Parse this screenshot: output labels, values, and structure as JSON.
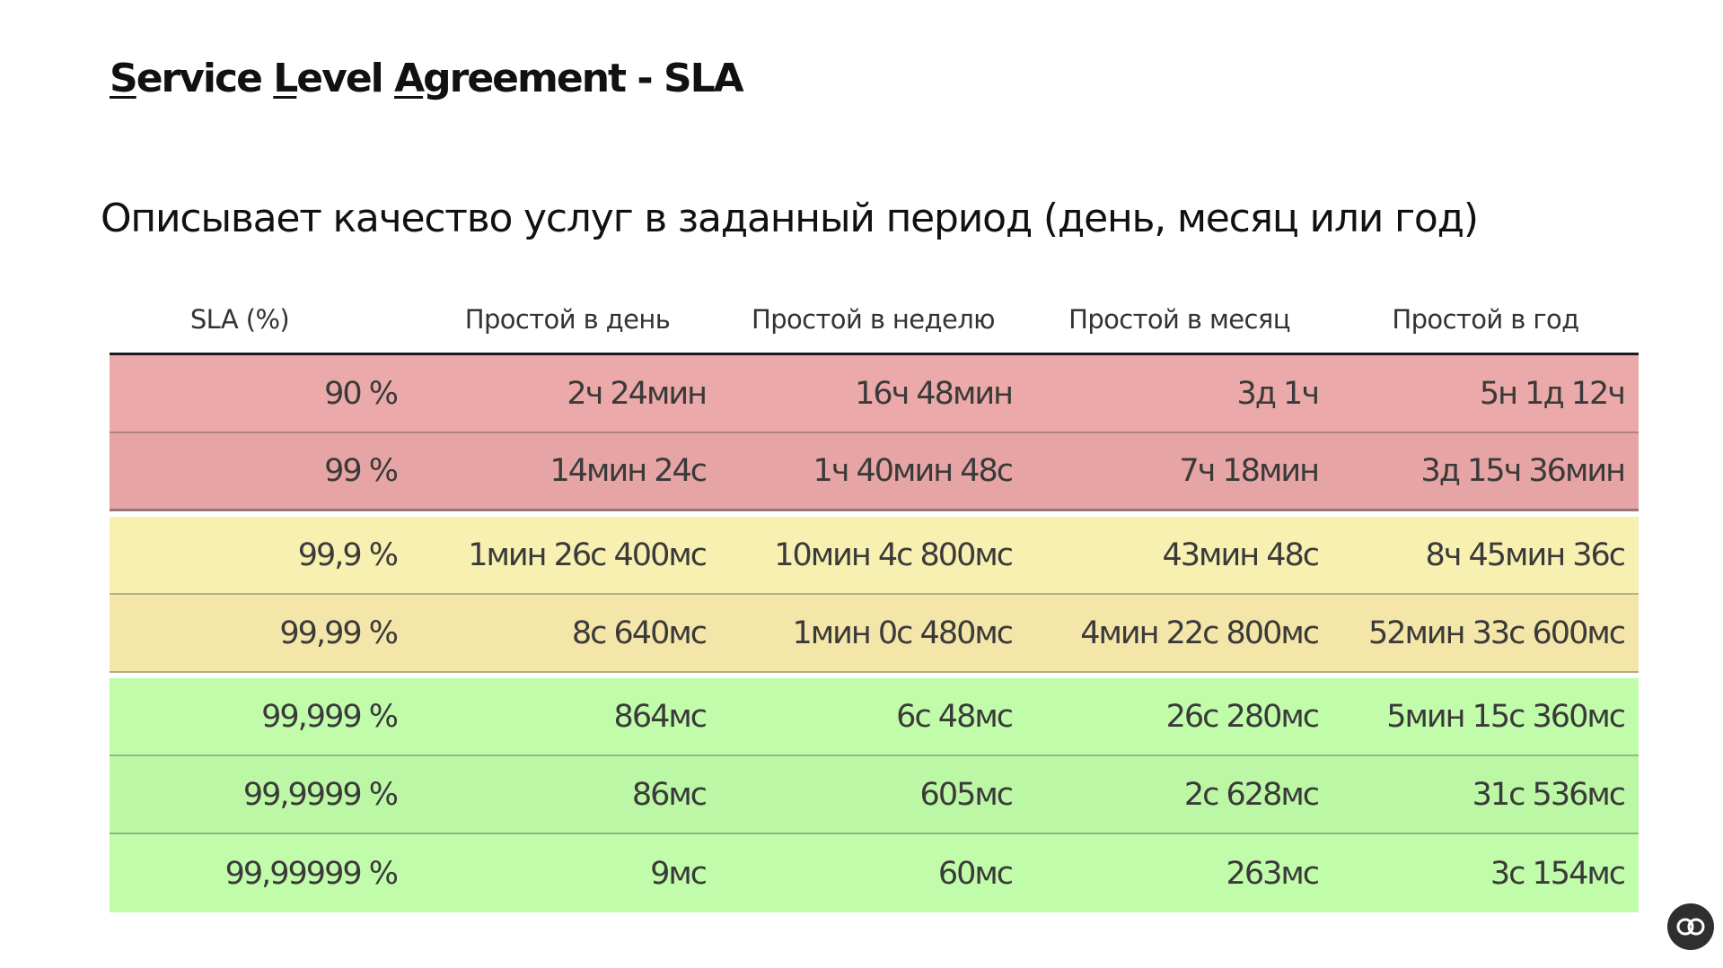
{
  "title": {
    "parts": [
      {
        "text": "S",
        "underline": true
      },
      {
        "text": "ervice ",
        "underline": false
      },
      {
        "text": "L",
        "underline": true
      },
      {
        "text": "evel ",
        "underline": false
      },
      {
        "text": "A",
        "underline": true
      },
      {
        "text": "greement - SLA",
        "underline": false
      }
    ]
  },
  "subtitle": "Описывает качество услуг в заданный период (день, месяц или год)",
  "table": {
    "headers": [
      "SLA (%)",
      "Простой в день",
      "Простой в неделю",
      "Простой в месяц",
      "Простой в год"
    ],
    "rows": [
      {
        "group": "red",
        "cells": [
          "90 %",
          "2ч 24мин",
          "16ч 48мин",
          "3д 1ч",
          "5н 1д 12ч"
        ]
      },
      {
        "group": "red",
        "cells": [
          "99 %",
          "14мин 24с",
          "1ч 40мин 48с",
          "7ч 18мин",
          "3д 15ч 36мин"
        ]
      },
      {
        "group": "yellow",
        "cells": [
          "99,9 %",
          "1мин 26с 400мс",
          "10мин 4с 800мс",
          "43мин 48с",
          "8ч 45мин 36с"
        ]
      },
      {
        "group": "yellow",
        "cells": [
          "99,99 %",
          "8с 640мс",
          "1мин 0с 480мс",
          "4мин 22с 800мс",
          "52мин 33с 600мс"
        ]
      },
      {
        "group": "green",
        "cells": [
          "99,999 %",
          "864мс",
          "6с 48мс",
          "26с 280мс",
          "5мин 15с 360мс"
        ]
      },
      {
        "group": "green",
        "cells": [
          "99,9999 %",
          "86мс",
          "605мс",
          "2с 628мс",
          "31с 536мс"
        ]
      },
      {
        "group": "green",
        "cells": [
          "99,99999 %",
          "9мс",
          "60мс",
          "263мс",
          "3с 154мс"
        ]
      }
    ]
  },
  "colors": {
    "red": "#eba9a9",
    "yellow": "#f8f0b0",
    "green": "#c1fcaa"
  },
  "corner_logo": {
    "icon": "overlapping-loops-logo-icon",
    "glyph": "&"
  }
}
